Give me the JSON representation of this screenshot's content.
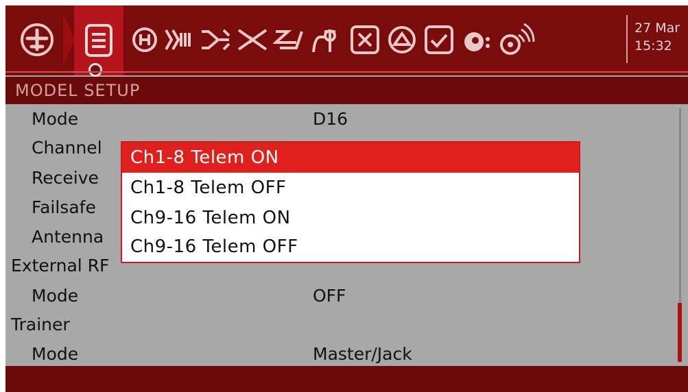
{
  "topbar": {
    "icons": [
      "airplane-icon",
      "model-setup-icon",
      "heli-icon",
      "inputs-icon",
      "mixer-icon",
      "outputs-icon",
      "curves-icon",
      "logical-switches-icon",
      "special-functions-icon",
      "custom-scripts-icon",
      "telemetry-icon",
      "checklist-icon",
      "display-icon",
      "sound-icon"
    ],
    "date_line1": "27 Mar",
    "date_line2": "15:32"
  },
  "title": "MODEL SETUP",
  "rows": [
    {
      "label": "Mode",
      "value": "D16"
    },
    {
      "label": "Channel",
      "value": ""
    },
    {
      "label": "Receive",
      "value": ""
    },
    {
      "label": "Failsafe",
      "value": ""
    },
    {
      "label": "Antenna",
      "value": ""
    },
    {
      "label": "External RF",
      "value": ""
    },
    {
      "label": "Mode",
      "value": "OFF"
    },
    {
      "label": "Trainer",
      "value": ""
    },
    {
      "label": "Mode",
      "value": "Master/Jack"
    }
  ],
  "popup": {
    "options": [
      "Ch1-8 Telem ON",
      "Ch1-8 Telem OFF",
      "Ch9-16 Telem ON",
      "Ch9-16 Telem OFF"
    ],
    "selected": 0
  },
  "colors": {
    "topbar": "#7a0c0c",
    "accent": "#e0201c",
    "content_bg": "#a8a8a8"
  }
}
